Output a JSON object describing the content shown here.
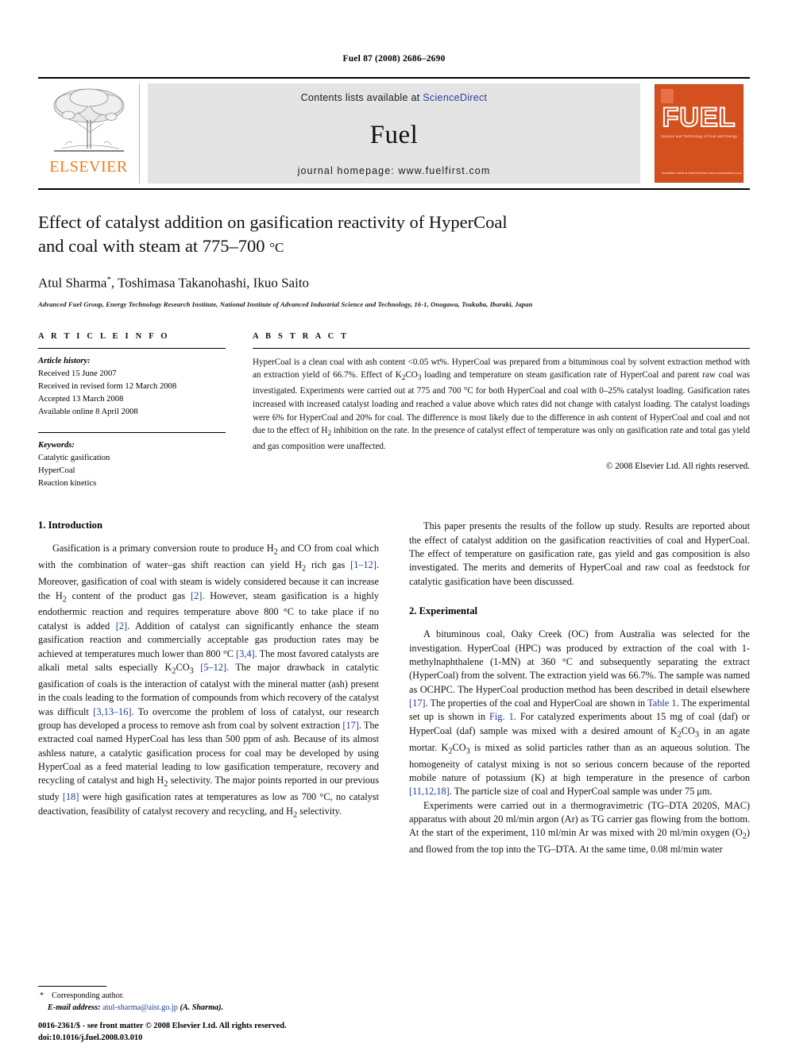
{
  "running_head": "Fuel 87 (2008) 2686–2690",
  "banner": {
    "publisher_name": "ELSEVIER",
    "contents_prefix": "Contents lists available at ",
    "contents_link": "ScienceDirect",
    "journal_name": "Fuel",
    "homepage": "journal homepage: www.fuelfirst.com",
    "cover_title": "FUEL",
    "cover_subtitle": "Science and Technology of Fuel and Energy",
    "cover_footer": "Available online at ScienceDirect www.sciencedirect.com"
  },
  "article": {
    "title_line1": "Effect of catalyst addition on gasification reactivity of HyperCoal",
    "title_line2": "and coal with steam at 775–700 ",
    "title_deg": "°C",
    "authors_pre": "Atul Sharma",
    "authors_star": "*",
    "authors_post": ", Toshimasa Takanohashi, Ikuo Saito",
    "affiliation": "Advanced Fuel Group, Energy Technology Research Institute, National Institute of Advanced Industrial Science and Technology, 16-1, Onogawa, Tsukuba, Ibaraki, Japan"
  },
  "article_info": {
    "label": "A R T I C L E   I N F O",
    "history_head": "Article history:",
    "history": [
      "Received 15 June 2007",
      "Received in revised form 12 March 2008",
      "Accepted 13 March 2008",
      "Available online 8 April 2008"
    ],
    "keywords_head": "Keywords:",
    "keywords": [
      "Catalytic gasification",
      "HyperCoal",
      "Reaction kinetics"
    ]
  },
  "abstract": {
    "label": "A B S T R A C T",
    "text": "HyperCoal is a clean coal with ash content <0.05 wt%. HyperCoal was prepared from a bituminous coal by solvent extraction method with an extraction yield of 66.7%. Effect of K2CO3 loading and temperature on steam gasification rate of HyperCoal and parent raw coal was investigated. Experiments were carried out at 775 and 700 °C for both HyperCoal and coal with 0–25% catalyst loading. Gasification rates increased with increased catalyst loading and reached a value above which rates did not change with catalyst loading. The catalyst loadings were 6% for HyperCoal and 20% for coal. The difference is most likely due to the difference in ash content of HyperCoal and coal and not due to the effect of H2 inhibition on the rate. In the presence of catalyst effect of temperature was only on gasification rate and total gas yield and gas composition were unaffected.",
    "copyright": "© 2008 Elsevier Ltd. All rights reserved."
  },
  "sections": {
    "introduction_title": "1. Introduction",
    "intro_p1": "Gasification is a primary conversion route to produce H2 and CO from coal which with the combination of water–gas shift reaction can yield H2 rich gas [1–12]. Moreover, gasification of coal with steam is widely considered because it can increase the H2 content of the product gas [2]. However, steam gasification is a highly endothermic reaction and requires temperature above 800 °C to take place if no catalyst is added [2]. Addition of catalyst can significantly enhance the steam gasification reaction and commercially acceptable gas production rates may be achieved at temperatures much lower than 800 °C [3,4]. The most favored catalysts are alkali metal salts especially K2CO3 [5–12]. The major drawback in catalytic gasification of coals is the interaction of catalyst with the mineral matter (ash) present in the coals leading to the formation of compounds from which recovery of the catalyst was difficult [3,13–16]. To overcome the problem of loss of catalyst, our research group has developed a process to remove ash from coal by solvent extraction [17]. The extracted coal named HyperCoal has less than 500 ppm of ash. Because of its almost ashless nature, a catalytic gasification process for coal may be developed by using HyperCoal as a feed material leading to low gasification temperature, recovery and recycling of catalyst and high H2 selectivity. The major points reported in our previous study [18] were high gasification rates at temperatures as low as 700 °C, no catalyst deactivation, feasibility of catalyst recovery and recycling, and H2 selectivity.",
    "intro_p2": "This paper presents the results of the follow up study. Results are reported about the effect of catalyst addition on the gasification reactivities of coal and HyperCoal. The effect of temperature on gasification rate, gas yield and gas composition is also investigated. The merits and demerits of HyperCoal and raw coal as feedstock for catalytic gasification have been discussed.",
    "experimental_title": "2. Experimental",
    "exp_p1": "A bituminous coal, Oaky Creek (OC) from Australia was selected for the investigation. HyperCoal (HPC) was produced by extraction of the coal with 1-methylnaphthalene (1-MN) at 360 °C and subsequently separating the extract (HyperCoal) from the solvent. The extraction yield was 66.7%. The sample was named as OCHPC. The HyperCoal production method has been described in detail elsewhere [17]. The properties of the coal and HyperCoal are shown in Table 1. The experimental set up is shown in Fig. 1. For catalyzed experiments about 15 mg of coal (daf) or HyperCoal (daf) sample was mixed with a desired amount of K2CO3 in an agate mortar. K2CO3 is mixed as solid particles rather than as an aqueous solution. The homogeneity of catalyst mixing is not so serious concern because of the reported mobile nature of potassium (K) at high temperature in the presence of carbon [11,12,18]. The particle size of coal and HyperCoal sample was under 75 μm.",
    "exp_p2": "Experiments were carried out in a thermogravimetric (TG–DTA 2020S, MAC) apparatus with about 20 ml/min argon (Ar) as TG carrier gas flowing from the bottom. At the start of the experiment, 110 ml/min Ar was mixed with 20 ml/min oxygen (O2) and flowed from the top into the TG–DTA. At the same time, 0.08 ml/min water"
  },
  "footnote": {
    "star": "*",
    "corresponding": "Corresponding author.",
    "email_label": "E-mail address:",
    "email": "atul-sharma@aist.go.jp",
    "email_suffix": "(A. Sharma)."
  },
  "footer": {
    "issn_line": "0016-2361/$ - see front matter © 2008 Elsevier Ltd. All rights reserved.",
    "doi_line": "doi:10.1016/j.fuel.2008.03.010"
  },
  "colors": {
    "link": "#1f3a93",
    "elsevier_orange": "#ef7d1a",
    "cover_orange": "#d4501e",
    "banner_gray": "#e4e4e4"
  }
}
